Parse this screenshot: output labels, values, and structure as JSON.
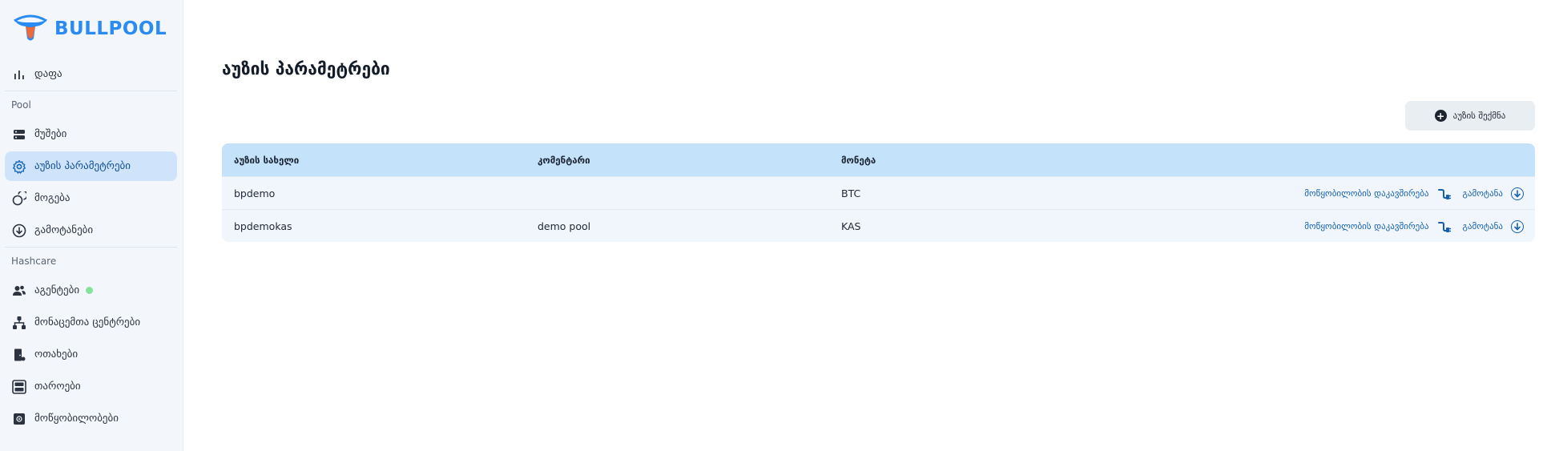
{
  "app": {
    "logo_text": "BULLPOOL",
    "brand_color": "#2a8bf2",
    "accent_color": "#cfe4fb"
  },
  "sidebar": {
    "top_item": {
      "label": "დაფა",
      "icon": "bar-chart-icon"
    },
    "sections": [
      {
        "title": "Pool",
        "items": [
          {
            "label": "მუშები",
            "icon": "server-icon"
          },
          {
            "label": "აუზის პარამეტრები",
            "icon": "gear-icon",
            "active": true
          },
          {
            "label": "მოგება",
            "icon": "coins-icon"
          },
          {
            "label": "გამოტანები",
            "icon": "download-circle-icon"
          }
        ]
      },
      {
        "title": "Hashcare",
        "items": [
          {
            "label": "აგენტები",
            "icon": "users-icon",
            "status_color": "#86e29b"
          },
          {
            "label": "მონაცემთა ცენტრები",
            "icon": "sitemap-icon"
          },
          {
            "label": "ოთახები",
            "icon": "door-icon"
          },
          {
            "label": "თაროები",
            "icon": "rack-icon"
          },
          {
            "label": "მოწყობილობები",
            "icon": "chip-icon"
          }
        ]
      }
    ]
  },
  "main": {
    "title": "აუზის პარამეტრები",
    "add_button": "აუზის შექმნა",
    "table": {
      "columns": [
        "აუზის სახელი",
        "კომენტარი",
        "მონეტა"
      ],
      "rows": [
        {
          "name": "bpdemo",
          "comment": "",
          "coin": "BTC"
        },
        {
          "name": "bpdemokas",
          "comment": "demo pool",
          "coin": "KAS"
        }
      ],
      "row_actions": {
        "connect_label": "მოწყობილობის დაკავშირება",
        "export_label": "გამოტანა"
      }
    }
  }
}
